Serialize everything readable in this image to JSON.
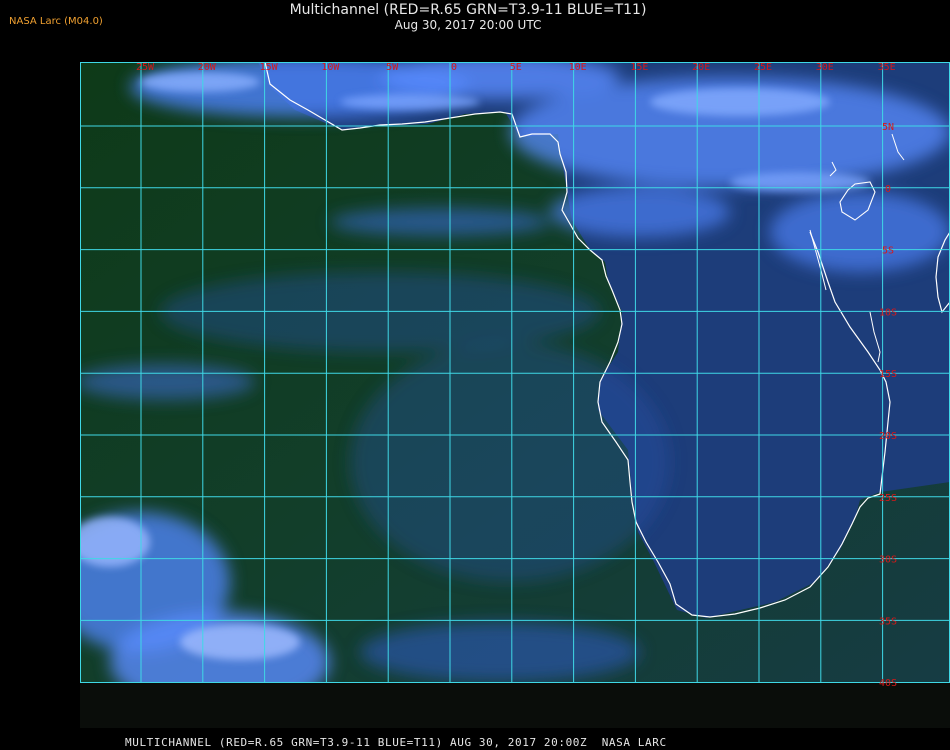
{
  "header": {
    "logo": "NASA Larc (M04.0)",
    "title": "Multichannel (RED=R.65 GRN=T3.9-11 BLUE=T11)",
    "subtitle": "Aug 30, 2017 20:00 UTC"
  },
  "map": {
    "longitude_labels": [
      "25W",
      "20W",
      "15W",
      "10W",
      "5W",
      "0",
      "5E",
      "10E",
      "15E",
      "20E",
      "25E",
      "30E",
      "35E"
    ],
    "latitude_labels": [
      "5N",
      "0",
      "5S",
      "10S",
      "15S",
      "20S",
      "25S",
      "30S",
      "35S",
      "40S"
    ],
    "colors": {
      "grid": "#3fd8e6",
      "coast": "#ffffff",
      "labels": "#d81818",
      "ocean": "#0f3a1c",
      "land": "#1e3f7c",
      "cloud": "#5a8aff"
    }
  },
  "footer": {
    "caption": "MULTICHANNEL (RED=R.65 GRN=T3.9-11 BLUE=T11) AUG 30, 2017 20:00Z  NASA LARC"
  }
}
